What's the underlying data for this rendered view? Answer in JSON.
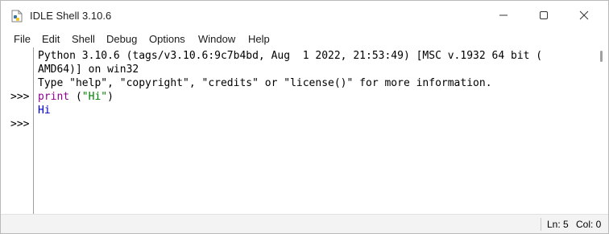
{
  "window": {
    "title": "IDLE Shell 3.10.6",
    "app_icon": "python-feather-icon",
    "controls": [
      "minimize-icon",
      "maximize-icon",
      "close-icon"
    ]
  },
  "menu": {
    "items": [
      {
        "label": "File"
      },
      {
        "label": "Edit"
      },
      {
        "label": "Shell"
      },
      {
        "label": "Debug"
      },
      {
        "label": "Options"
      },
      {
        "label": "Window"
      },
      {
        "label": "Help"
      }
    ]
  },
  "shell": {
    "prompts": [
      ">>>",
      ">>>"
    ],
    "lines": [
      {
        "text": "Python 3.10.6 (tags/v3.10.6:9c7b4bd, Aug  1 2022, 21:53:49) [MSC v.1932 64 bit ("
      },
      {
        "text": "AMD64)] on win32"
      },
      {
        "text": "Type \"help\", \"copyright\", \"credits\" or \"license()\" for more information."
      },
      {
        "keyword": "print",
        "space": " ",
        "open": "(",
        "string": "\"Hi\"",
        "close": ")"
      },
      {
        "text": "Hi"
      }
    ],
    "colors": {
      "keyword": "#900090",
      "string": "#008000"
    }
  },
  "status": {
    "line": "Ln: 5",
    "col": "Col: 0"
  }
}
